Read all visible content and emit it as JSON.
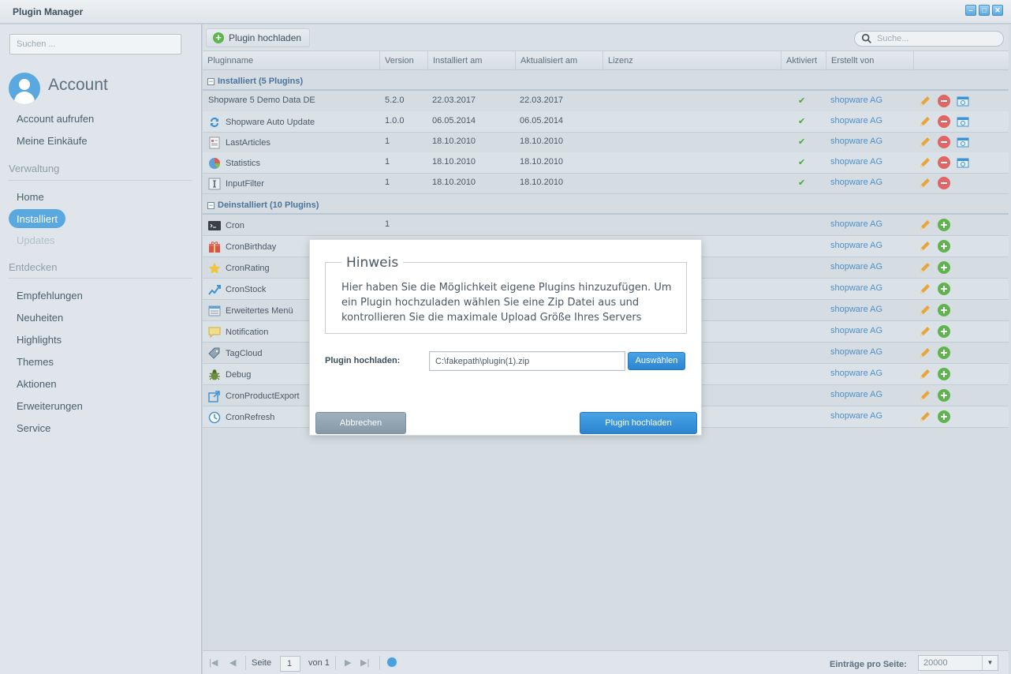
{
  "window": {
    "title": "Plugin Manager"
  },
  "sidebar": {
    "search_placeholder": "Suchen ...",
    "account_title": "Account",
    "account_items": [
      "Account aufrufen",
      "Meine Einkäufe"
    ],
    "section_manage": "Verwaltung",
    "manage_items": {
      "home": "Home",
      "installed": "Installiert",
      "updates": "Updates"
    },
    "section_discover": "Entdecken",
    "discover_items": [
      "Empfehlungen",
      "Neuheiten",
      "Highlights",
      "Themes",
      "Aktionen",
      "Erweiterungen",
      "Service"
    ]
  },
  "toolbar": {
    "upload_label": "Plugin hochladen",
    "search_placeholder": "Suche..."
  },
  "grid": {
    "columns": {
      "name": "Pluginname",
      "version": "Version",
      "installed": "Installiert am",
      "updated": "Aktualisiert am",
      "license": "Lizenz",
      "active": "Aktiviert",
      "author": "Erstellt von"
    },
    "installed_group": "Installiert (5 Plugins)",
    "installed": [
      {
        "name": "Shopware 5 Demo Data DE",
        "version": "5.2.0",
        "installed": "22.03.2017",
        "updated": "22.03.2017",
        "author": "shopware AG",
        "icon": "none"
      },
      {
        "name": "Shopware Auto Update",
        "version": "1.0.0",
        "installed": "06.05.2014",
        "updated": "06.05.2014",
        "author": "shopware AG",
        "icon": "refresh-arrows-icon"
      },
      {
        "name": "LastArticles",
        "version": "1",
        "installed": "18.10.2010",
        "updated": "18.10.2010",
        "author": "shopware AG",
        "icon": "list-document-icon"
      },
      {
        "name": "Statistics",
        "version": "1",
        "installed": "18.10.2010",
        "updated": "18.10.2010",
        "author": "shopware AG",
        "icon": "pie-chart-icon"
      },
      {
        "name": "InputFilter",
        "version": "1",
        "installed": "18.10.2010",
        "updated": "18.10.2010",
        "author": "shopware AG",
        "icon": "text-cursor-icon"
      }
    ],
    "uninstalled_group": "Deinstalliert (10 Plugins)",
    "uninstalled": [
      {
        "name": "Cron",
        "version": "1",
        "author": "shopware AG",
        "icon": "terminal-icon"
      },
      {
        "name": "CronBirthday",
        "version": "",
        "author": "shopware AG",
        "icon": "gift-icon"
      },
      {
        "name": "CronRating",
        "version": "",
        "author": "shopware AG",
        "icon": "star-icon"
      },
      {
        "name": "CronStock",
        "version": "",
        "author": "shopware AG",
        "icon": "stock-chart-icon"
      },
      {
        "name": "Erweitertes Menü",
        "version": "",
        "author": "shopware AG",
        "icon": "menu-icon"
      },
      {
        "name": "Notification",
        "version": "",
        "author": "shopware AG",
        "icon": "speech-bubble-icon"
      },
      {
        "name": "TagCloud",
        "version": "",
        "author": "shopware AG",
        "icon": "tag-icon"
      },
      {
        "name": "Debug",
        "version": "",
        "author": "shopware AG",
        "icon": "bug-icon"
      },
      {
        "name": "CronProductExport",
        "version": "",
        "author": "shopware AG",
        "icon": "export-icon"
      },
      {
        "name": "CronRefresh",
        "version": "",
        "author": "shopware AG",
        "icon": "clock-icon"
      }
    ]
  },
  "pager": {
    "page_label": "Seite",
    "page_value": "1",
    "of_label": "von 1",
    "per_page_label": "Einträge pro Seite:",
    "per_page_value": "20000"
  },
  "dialog": {
    "legend": "Hinweis",
    "hint": "Hier haben Sie die Möglichkeit eigene Plugins hinzuzufügen. Um ein Plugin hochzuladen wählen Sie eine Zip Datei aus und kontrollieren Sie die maximale Upload Größe Ihres Servers",
    "field_label": "Plugin hochladen:",
    "field_value": "C:\\fakepath\\plugin(1).zip",
    "choose_label": "Auswählen",
    "cancel_label": "Abbrechen",
    "submit_label": "Plugin hochladen"
  },
  "colors": {
    "accent": "#5aa8e0",
    "link": "#4e8fc9",
    "success": "#5fb44d",
    "danger": "#e06565"
  }
}
